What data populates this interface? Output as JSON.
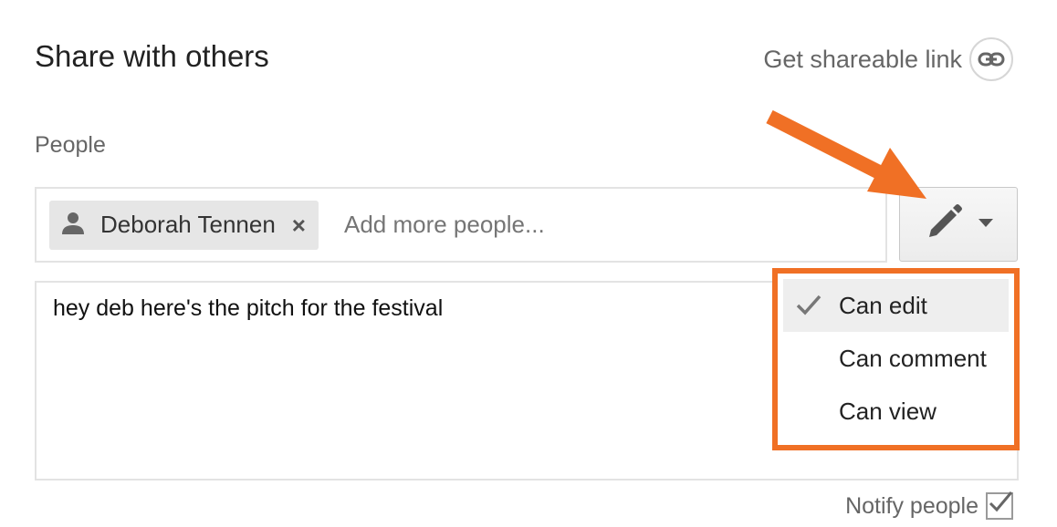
{
  "dialog": {
    "title": "Share with others",
    "share_link_label": "Get shareable link",
    "people_label": "People",
    "chip": {
      "name": "Deborah Tennen",
      "remove_glyph": "×",
      "icon": "person-icon"
    },
    "add_people_placeholder": "Add more people...",
    "permission_button": {
      "icon": "pencil-icon",
      "caret": "caret-down-icon"
    },
    "message": "hey deb here's the pitch for the festival",
    "permission_menu": {
      "items": [
        {
          "label": "Can edit",
          "selected": true
        },
        {
          "label": "Can comment",
          "selected": false
        },
        {
          "label": "Can view",
          "selected": false
        }
      ]
    },
    "notify_label": "Notify people",
    "notify_checked": true
  },
  "colors": {
    "annotation_orange": "#f07025",
    "text_gray": "#666666",
    "border_gray": "#e3e3e3"
  }
}
